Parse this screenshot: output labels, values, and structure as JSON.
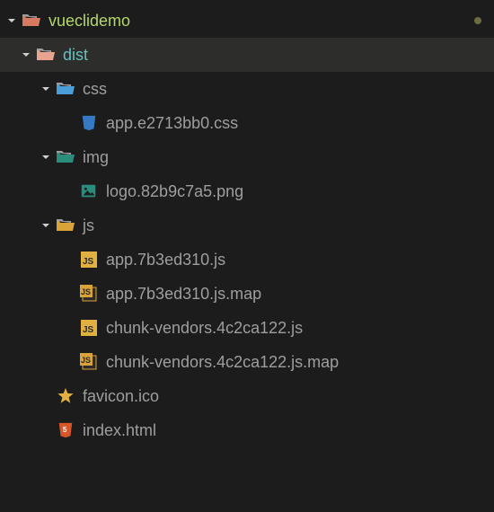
{
  "tree": {
    "root": {
      "label": "vueclidemo"
    },
    "dist": {
      "label": "dist"
    },
    "css": {
      "label": "css"
    },
    "css_file": {
      "label": "app.e2713bb0.css"
    },
    "img": {
      "label": "img"
    },
    "img_file": {
      "label": "logo.82b9c7a5.png"
    },
    "js": {
      "label": "js"
    },
    "js_files": [
      {
        "label": "app.7b3ed310.js"
      },
      {
        "label": "app.7b3ed310.js.map"
      },
      {
        "label": "chunk-vendors.4c2ca122.js"
      },
      {
        "label": "chunk-vendors.4c2ca122.js.map"
      }
    ],
    "favicon": {
      "label": "favicon.ico"
    },
    "index": {
      "label": "index.html"
    }
  },
  "colors": {
    "root_folder": "#d87a62",
    "dist_folder": "#e8a490",
    "css_folder": "#4a9fd8",
    "css_file": "#3578c4",
    "img_folder": "#2a8c7a",
    "img_file": "#2a8c7a",
    "js_folder": "#d9a33a",
    "js_file": "#e0b040",
    "jsmap_file": "#d9a33a",
    "star": "#e0b040",
    "html": "#d8572a"
  }
}
